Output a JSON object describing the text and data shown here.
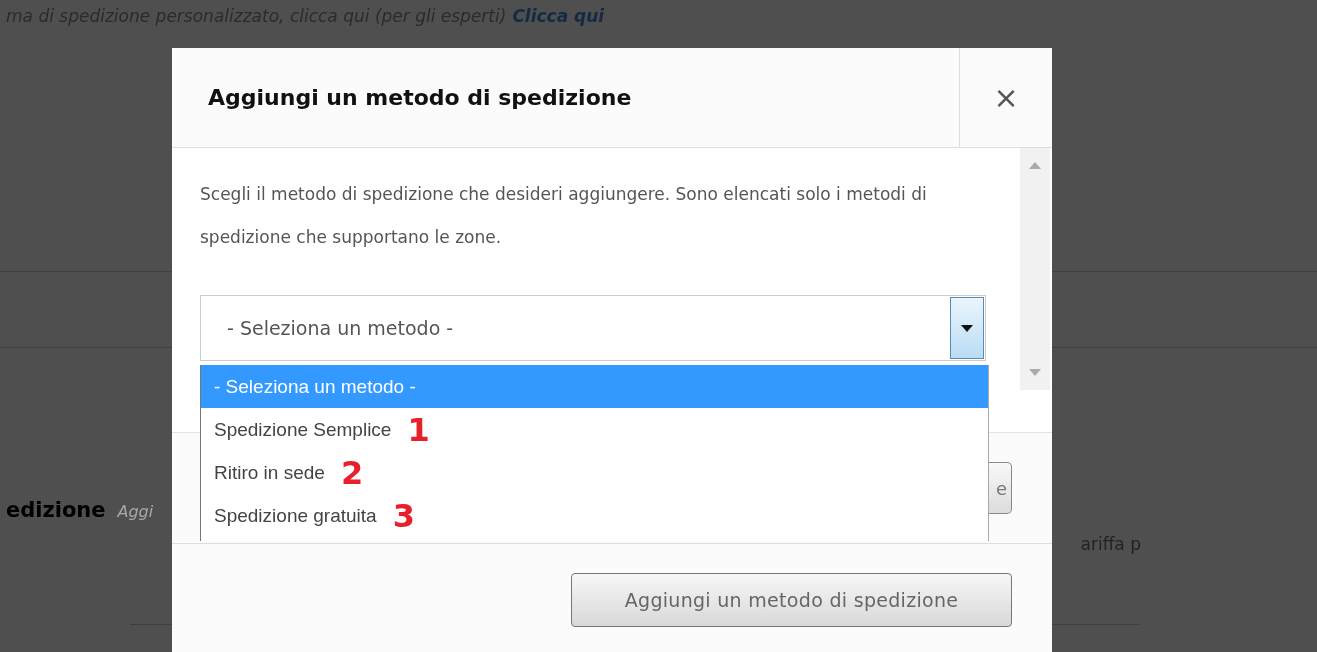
{
  "background": {
    "intro": "ma di spedizione personalizzato, clicca qui (per gli esperti)",
    "intro_link": "Clicca qui",
    "section_title": "edizione",
    "section_hint": "Aggi",
    "column_text": "ariffa p",
    "hidden_button": "e"
  },
  "dialog": {
    "title": "Aggiungi un metodo di spedizione",
    "close": "×",
    "description": "Scegli il metodo di spedizione che desideri aggiungere. Sono elencati solo i metodi di spedizione che supportano le zone.",
    "select": {
      "value": "- Seleziona un metodo -",
      "expanded": true,
      "options": [
        {
          "label": "- Seleziona un metodo -",
          "selected": true
        },
        {
          "label": "Spedizione Semplice",
          "marker": "1",
          "selected": false
        },
        {
          "label": "Ritiro in sede",
          "marker": "2",
          "selected": false
        },
        {
          "label": "Spedizione gratuita",
          "marker": "3",
          "selected": false
        }
      ]
    },
    "submit": "Aggiungi un metodo di spedizione"
  }
}
